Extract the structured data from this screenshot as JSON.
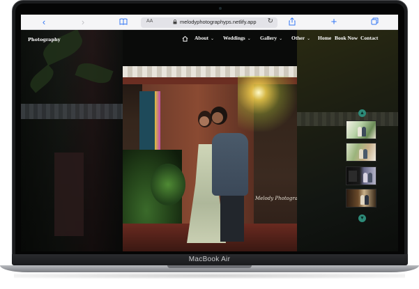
{
  "device": {
    "brand_label": "MacBook Air"
  },
  "browser": {
    "text_size_label": "AA",
    "url": "melodyphotographyps.netlify.app",
    "back_icon": "chevron-left-icon",
    "forward_icon": "chevron-right-icon",
    "sidebar_icon": "book-icon",
    "reload_icon": "reload-icon",
    "share_icon": "share-icon",
    "new_tab_icon": "plus-icon",
    "tabs_icon": "tabs-icon",
    "accent_color": "#3478f6"
  },
  "site": {
    "logo": "Photography",
    "nav": [
      {
        "label": "Home",
        "has_dropdown": false
      },
      {
        "label": "About",
        "has_dropdown": true
      },
      {
        "label": "Weddings",
        "has_dropdown": true
      },
      {
        "label": "Gallery",
        "has_dropdown": true
      },
      {
        "label": "Other",
        "has_dropdown": true
      },
      {
        "label": "Home",
        "has_dropdown": false
      },
      {
        "label": "Book Now",
        "has_dropdown": false
      },
      {
        "label": "Contact",
        "has_dropdown": false
      }
    ],
    "dropdown_glyph": "⌄",
    "hero_watermark": "Melody Photography",
    "thumbnails_count": 4,
    "thumb_nav_color": "#2d8a78"
  }
}
